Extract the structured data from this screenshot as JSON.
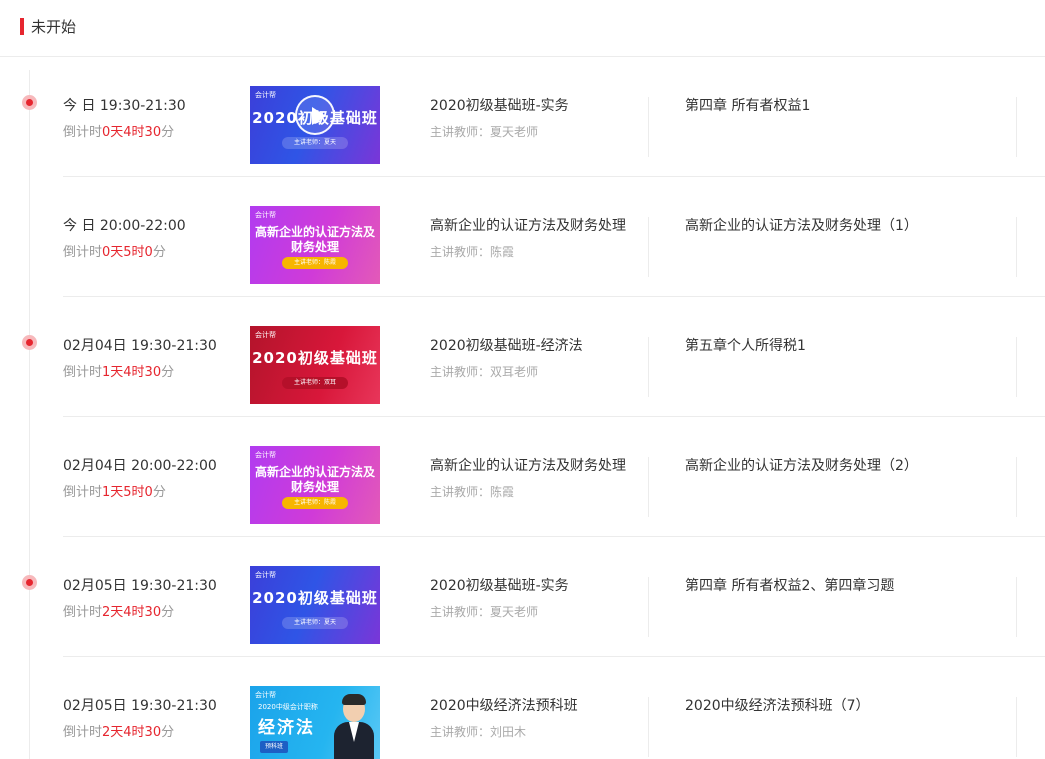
{
  "section": {
    "title": "未开始"
  },
  "thumb_logo": "会计帮",
  "rows": [
    {
      "time": "今 日 19:30-21:30",
      "countdown_prefix": "倒计时",
      "countdown_value": "0天4时30",
      "countdown_suffix": "分",
      "thumb_style": "blue",
      "thumb_text": "2020初级基础班",
      "thumb_teacher": "主讲老师：夏天",
      "has_play": true,
      "course": "2020初级基础班-实务",
      "teacher": "主讲教师：夏天老师",
      "chapter": "第四章 所有者权益1",
      "has_dot": true
    },
    {
      "time": "今 日 20:00-22:00",
      "countdown_prefix": "倒计时",
      "countdown_value": "0天5时0",
      "countdown_suffix": "分",
      "thumb_style": "purple",
      "thumb_text": "高新企业的认证方法及",
      "thumb_text2": "财务处理",
      "thumb_teacher": "主讲老师：陈霞",
      "has_play": false,
      "course": "高新企业的认证方法及财务处理",
      "teacher": "主讲教师：陈霞",
      "chapter": "高新企业的认证方法及财务处理（1）",
      "has_dot": false
    },
    {
      "time": "02月04日 19:30-21:30",
      "countdown_prefix": "倒计时",
      "countdown_value": "1天4时30",
      "countdown_suffix": "分",
      "thumb_style": "red",
      "thumb_text": "2020初级基础班",
      "thumb_teacher": "主讲老师：双耳",
      "has_play": false,
      "course": "2020初级基础班-经济法",
      "teacher": "主讲教师：双耳老师",
      "chapter": "第五章个人所得税1",
      "has_dot": true
    },
    {
      "time": "02月04日 20:00-22:00",
      "countdown_prefix": "倒计时",
      "countdown_value": "1天5时0",
      "countdown_suffix": "分",
      "thumb_style": "purple",
      "thumb_text": "高新企业的认证方法及",
      "thumb_text2": "财务处理",
      "thumb_teacher": "主讲老师：陈霞",
      "has_play": false,
      "course": "高新企业的认证方法及财务处理",
      "teacher": "主讲教师：陈霞",
      "chapter": "高新企业的认证方法及财务处理（2）",
      "has_dot": false
    },
    {
      "time": "02月05日 19:30-21:30",
      "countdown_prefix": "倒计时",
      "countdown_value": "2天4时30",
      "countdown_suffix": "分",
      "thumb_style": "blue",
      "thumb_text": "2020初级基础班",
      "thumb_teacher": "主讲老师：夏天",
      "has_play": false,
      "course": "2020初级基础班-实务",
      "teacher": "主讲教师：夏天老师",
      "chapter": "第四章 所有者权益2、第四章习题",
      "has_dot": true
    },
    {
      "time": "02月05日 19:30-21:30",
      "countdown_prefix": "倒计时",
      "countdown_value": "2天4时30",
      "countdown_suffix": "分",
      "thumb_style": "cyan",
      "thumb_small": "2020中级会计职称",
      "thumb_text": "经济法",
      "thumb_badge": "预科班",
      "has_play": false,
      "course": "2020中级经济法预科班",
      "teacher": "主讲教师：刘田木",
      "chapter": "2020中级经济法预科班（7）",
      "has_dot": false
    }
  ]
}
